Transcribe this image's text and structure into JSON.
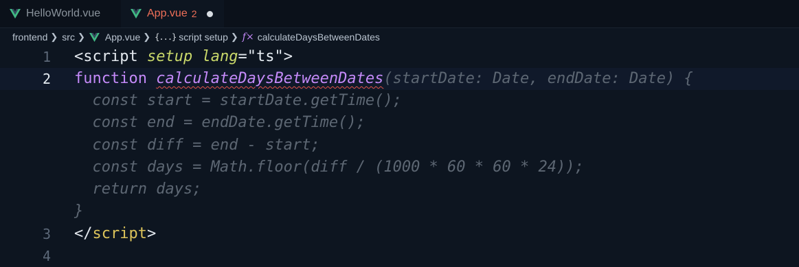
{
  "tabs": [
    {
      "label": "HelloWorld.vue",
      "icon": "vue-icon",
      "active": false
    },
    {
      "label": "App.vue",
      "icon": "vue-icon",
      "active": true,
      "problems": "2",
      "dirty": true
    }
  ],
  "breadcrumb": {
    "items": [
      "frontend",
      "src",
      "App.vue",
      "script setup",
      "calculateDaysBetweenDates"
    ],
    "brace_glyph": "{...}",
    "fx_glyph": "f×"
  },
  "editor": {
    "line_numbers": [
      "1",
      "2",
      "3",
      "4"
    ],
    "line1": {
      "open": "<",
      "tag": "script",
      "attr1": "setup",
      "attr2": "lang",
      "eq": "=",
      "val": "\"ts\"",
      "close": ">"
    },
    "line2": {
      "keyword": "function",
      "fname": "calculateDaysBetweenDates",
      "ghost_params": "(startDate: Date, endDate: Date) {"
    },
    "suggestion_lines": [
      "  const start = startDate.getTime();",
      "  const end = endDate.getTime();",
      "  const diff = end - start;",
      "  const days = Math.floor(diff / (1000 * 60 * 60 * 24));",
      "  return days;",
      "}"
    ],
    "line3": {
      "open": "</",
      "tag": "script",
      "close": ">"
    }
  },
  "colors": {
    "background": "#0d1520",
    "keyword": "#c58af9",
    "attribute": "#c9d86a",
    "error_squiggle": "#e5534b",
    "ghost_text": "#5d6773",
    "modified_tab": "#ef6f58"
  }
}
